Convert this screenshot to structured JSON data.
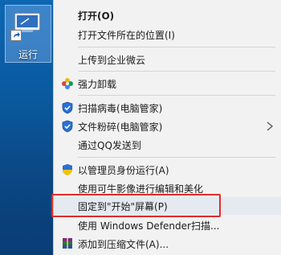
{
  "desktop": {
    "run_label": "运行"
  },
  "menu": {
    "items": [
      {
        "label": "打开(O)",
        "bold": true,
        "icon": null
      },
      {
        "label": "打开文件所在的位置(I)",
        "icon": null
      },
      {
        "label": "上传到企业微云",
        "icon": null
      },
      {
        "label": "强力卸载",
        "icon": "flower-icon"
      },
      {
        "label": "扫描病毒(电脑管家)",
        "icon": "shield-icon"
      },
      {
        "label": "文件粉碎(电脑管家)",
        "icon": "shield-icon"
      },
      {
        "label": "通过QQ发送到",
        "icon": null
      },
      {
        "label": "以管理员身份运行(A)",
        "icon": "uac-shield-icon"
      },
      {
        "label": "使用可牛影像进行编辑和美化",
        "icon": null
      },
      {
        "label": "固定到\"开始\"屏幕(P)",
        "icon": null
      },
      {
        "label": "使用 Windows Defender扫描...",
        "icon": null
      },
      {
        "label": "添加到压缩文件(A)...",
        "icon": "winrar-icon"
      }
    ],
    "submenu_arrow_icon": "chevron-right-icon"
  }
}
